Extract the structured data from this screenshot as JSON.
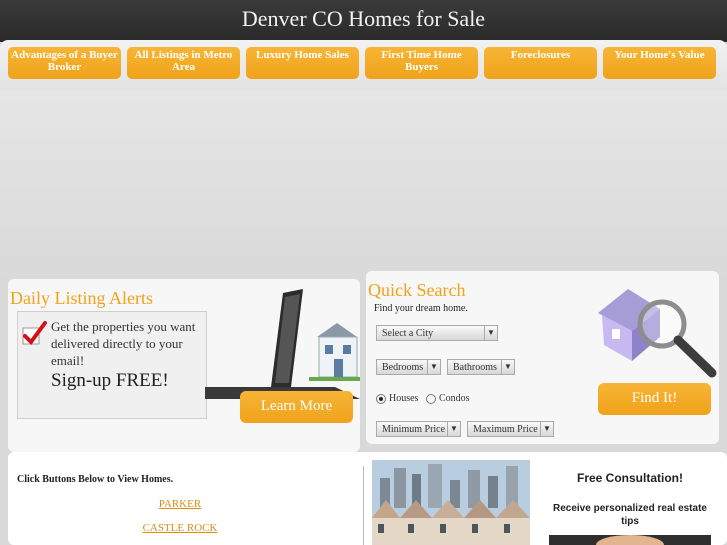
{
  "site": {
    "title": "Denver CO Homes for Sale"
  },
  "nav": [
    {
      "label": "Advantages of a Buyer Broker"
    },
    {
      "label": "All Listings in Metro Area"
    },
    {
      "label": "Luxury Home Sales"
    },
    {
      "label": "First Time Home Buyers"
    },
    {
      "label": "Foreclosures"
    },
    {
      "label": "Your Home's Value"
    }
  ],
  "alerts": {
    "heading": "Daily Listing Alerts",
    "text": "Get the properties you want delivered directly to your email!",
    "signup": "Sign-up FREE!",
    "button": "Learn More"
  },
  "quick_search": {
    "heading": "Quick Search",
    "subheading": "Find your dream home.",
    "city_select": "Select a City",
    "bedrooms_select": "Bedrooms",
    "bathrooms_select": "Bathrooms",
    "radio_houses": "Houses",
    "radio_condos": "Condos",
    "min_price_select": "Minimum Price",
    "max_price_select": "Maximum Price",
    "find_button": "Find It!"
  },
  "lower": {
    "title": "Click Buttons Below to View Homes.",
    "links": [
      "PARKER",
      "CASTLE ROCK"
    ],
    "consult_title": "Free Consultation!",
    "consult_sub": "Receive personalized real estate tips"
  },
  "colors": {
    "accent": "#f0a21a",
    "topbar": "#2f2f2f"
  }
}
